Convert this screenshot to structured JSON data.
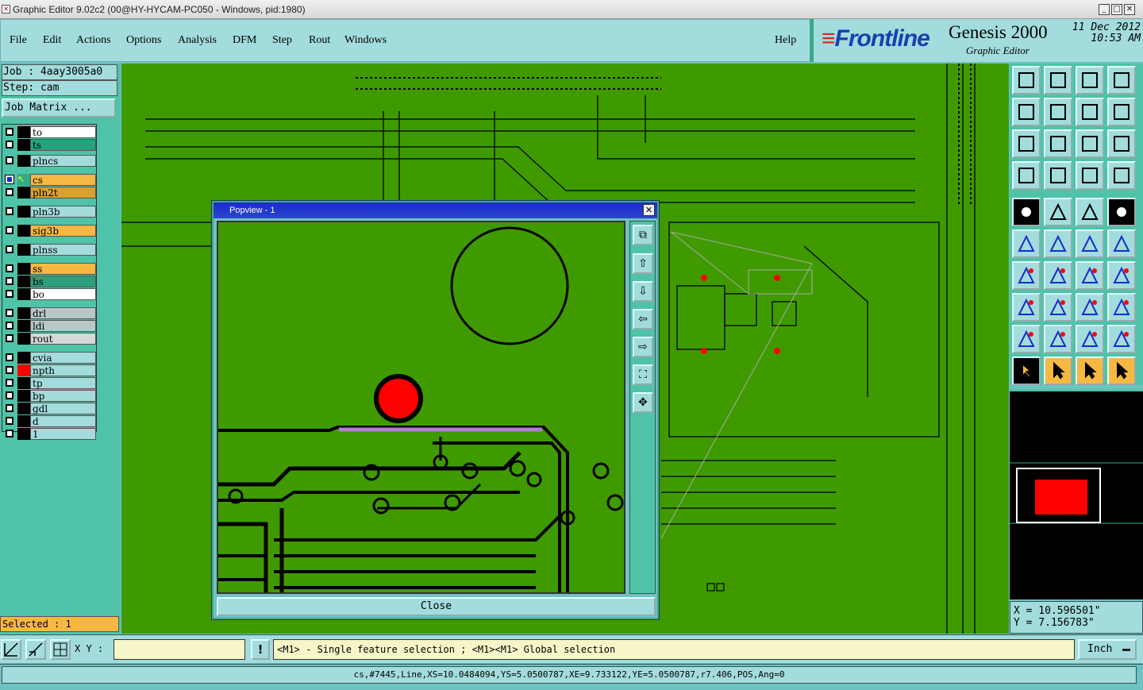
{
  "window": {
    "title": "Graphic Editor 9.02c2 (00@HY-HYCAM-PC050 - Windows, pid:1980)"
  },
  "menu": {
    "items": [
      "File",
      "Edit",
      "Actions",
      "Options",
      "Analysis",
      "DFM",
      "Step",
      "Rout",
      "Windows"
    ],
    "help": "Help"
  },
  "brand": {
    "logo_text": "Frontline",
    "product": "Genesis 2000",
    "module": "Graphic Editor",
    "date": "11 Dec 2012",
    "time": "10:53 AM"
  },
  "job": {
    "job_label": "Job : 4aay3005a0",
    "step_label": "Step: cam",
    "matrix_button": "Job Matrix ..."
  },
  "layers": [
    {
      "name": "to",
      "color": "#ffffff"
    },
    {
      "name": "ts",
      "color": "#2e9f7e"
    },
    {
      "name": "plncs",
      "color": "#a3dcdc"
    },
    {
      "name": "cs",
      "color": "#f6b843",
      "active": true
    },
    {
      "name": "pln2t",
      "color": "#d9a12d"
    },
    {
      "name": "pln3b",
      "color": "#a3dcdc"
    },
    {
      "name": "sig3b",
      "color": "#f6b843"
    },
    {
      "name": "plnss",
      "color": "#a3dcdc"
    },
    {
      "name": "ss",
      "color": "#f6b843"
    },
    {
      "name": "bs",
      "color": "#2e9f7e"
    },
    {
      "name": "bo",
      "color": "#ffffff"
    },
    {
      "name": "drl",
      "color": "#b8c8c8"
    },
    {
      "name": "ldi",
      "color": "#b8c8c8"
    },
    {
      "name": "rout",
      "color": "#d8d8d8"
    },
    {
      "name": "cvia",
      "color": "#a3dcdc"
    },
    {
      "name": "npth",
      "color": "#a3dcdc",
      "marker": "#ff0000"
    },
    {
      "name": "tp",
      "color": "#a3dcdc"
    },
    {
      "name": "bp",
      "color": "#a3dcdc"
    },
    {
      "name": "gdl",
      "color": "#a3dcdc"
    },
    {
      "name": "d",
      "color": "#a3dcdc"
    },
    {
      "name": "1",
      "color": "#a3dcdc"
    }
  ],
  "selected": "Selected : 1",
  "popview": {
    "title": "Popview - 1",
    "close_button": "Close"
  },
  "coords": {
    "x": "X = 10.596501\"",
    "y": "Y = 7.156783\""
  },
  "bottom": {
    "xy_label": "X Y :",
    "xy_value": "",
    "message": "<M1> - Single feature selection ; <M1><M1> Global selection",
    "unit": "Inch"
  },
  "status": "cs,#7445,Line,XS=10.0484094,YS=5.0500787,XE=9.733122,YE=5.0500787,r7.406,POS,Ang=0",
  "colors": {
    "board_green": "#3f9a00",
    "panel_teal": "#4fc3a7",
    "selection_red": "#ff0000",
    "highlight_purple": "#b77bdc"
  }
}
